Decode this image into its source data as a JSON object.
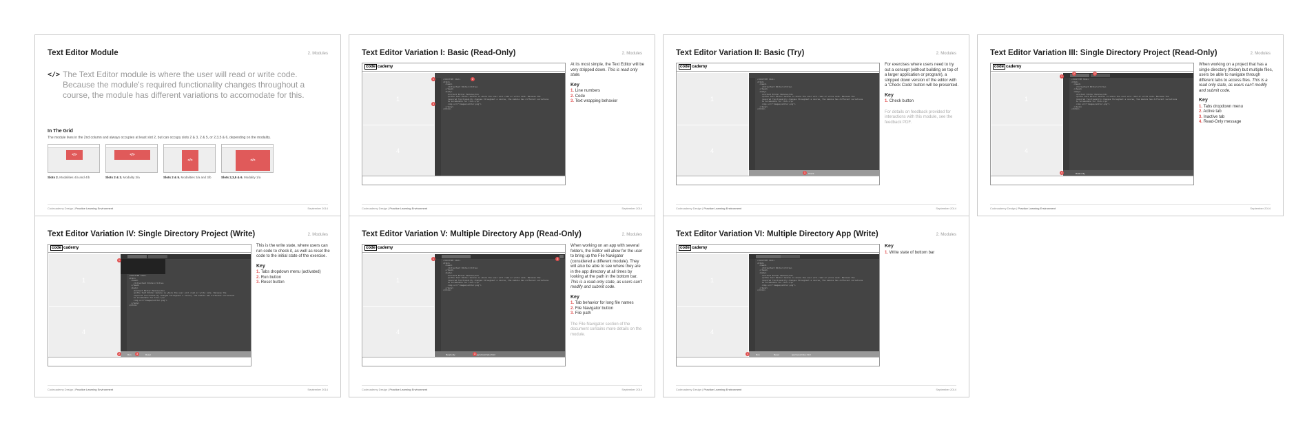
{
  "footer": {
    "left_prefix": "Codecademy Design |",
    "left_link": "Practice Learning Environment",
    "right": "September 2014"
  },
  "section_label": "2. Modules",
  "code_lines": "<!DOCTYPE html>\n<html>\n  <head>\n    <title>Text Editor</title>\n  </head>\n  <body>\n    <h1>Text Editor Module</h1>\n    <p>The Text Editor module is where the user will read or write code. Because the\n    required functionality changes throughout a course, the module has different variations\n    to accomodate for this.</p>\n    <img src=\"images/editor.png\">\n  </body>\n</html>",
  "logo": {
    "box": "code",
    "rest": "cademy"
  },
  "slides": [
    {
      "title": "Text Editor Module",
      "icon": "</>",
      "lead": "The Text Editor module is where the user will read or write code. Because the module's required functionality changes throughout a course, the module has different variations to accomodate for this.",
      "grid_heading": "In The Grid",
      "grid_desc": "The module lives in the 2nd column and always occupies at least slot 2, but can occupy slots 2 & 3, 2 & 5, or 2,3,5 & 6, depending on the modality.",
      "thumb_glyph": "</>",
      "captions": [
        {
          "bold": "Slots 2.",
          "text": " Modalities 4/a and 4/b"
        },
        {
          "bold": "Slots 2 & 3.",
          "text": " Modality 3/a"
        },
        {
          "bold": "Slots 2 & 5.",
          "text": " Modalities 3/a and 3/b"
        },
        {
          "bold": "Slots 2,3,5 & 6.",
          "text": " Modality 1/a"
        }
      ]
    },
    {
      "title": "Text Editor Variation I: Basic (Read-Only)",
      "desc": [
        "At its most simple, the Text Editor will be very stripped down. ",
        "This is read only state."
      ],
      "key": [
        "Line numbers",
        "Code",
        "Text wrapping behavior"
      ]
    },
    {
      "title": "Text Editor Variation II: Basic (Try)",
      "desc": [
        "For exercises where users need to try out a concept (without building on top of a larger application or program), a stripped down version of the editor with a 'Check Code' button will be presented."
      ],
      "key": [
        "Check button"
      ],
      "note": "For details on feedback provided for interactions with this module, see the feedback PDF.",
      "bar": "Check"
    },
    {
      "title": "Text Editor Variation III: Single Directory Project (Read-Only)",
      "desc": [
        "When working on a project that has a single directory (folder) but multiple files, users be able to navigate through different tabs to access files. ",
        "This is a read only state, as users can't modify and submit code."
      ],
      "key": [
        "Tabs dropdown menu",
        "Active tab",
        "Inactive tab",
        "Read-Only message"
      ],
      "bar": "Read-only"
    },
    {
      "title": "Text Editor Variation IV: Single Directory Project (Write)",
      "desc": [
        "This is the write state, where users can run code to check it, as well as reset the code to the initial state of the exercise."
      ],
      "key": [
        "Tabs dropdown menu (activated)",
        "Run button",
        "Reset button"
      ],
      "bar_run": "Run",
      "bar_reset": "Reset"
    },
    {
      "title": "Text Editor Variation V: Multiple Directory App (Read-Only)",
      "desc": [
        "When working on an app with several folders, the Editor will allow for the user to bring up the File Navigator (considered a different module). They will also be able to see where they are in the app directory at all times by looking at the path in the bottom bar. ",
        "This is a read-only state, as users can't modify and submit code."
      ],
      "key": [
        "Tab behavior for long file names",
        "File Navigator button",
        "File path"
      ],
      "note": "The File Navigator section of the document contains more details on the module.",
      "bar": "Read-only",
      "path": "app/views/index.html"
    },
    {
      "title": "Text Editor Variation VI: Multiple Directory App (Write)",
      "key": [
        "Write state of bottom bar"
      ],
      "bar_run": "Run",
      "bar_reset": "Reset",
      "path": "app/views/index.html"
    }
  ]
}
